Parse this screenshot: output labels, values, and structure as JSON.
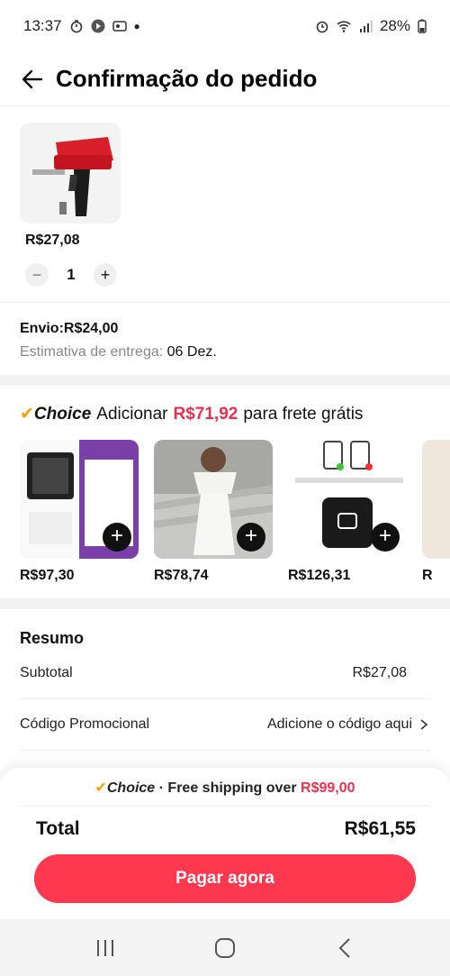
{
  "status": {
    "time": "13:37",
    "battery": "28%"
  },
  "header": {
    "title": "Confirmação do pedido"
  },
  "product": {
    "price": "R$27,08",
    "quantity": "1"
  },
  "shipping": {
    "label": "Envio:R$24,00",
    "estimate_label": "Estimativa de entrega:",
    "estimate_date": "06 Dez."
  },
  "choice": {
    "brand": "Choice",
    "add_text": "Adicionar",
    "amount": "R$71,92",
    "suffix": "para frete grátis",
    "items": [
      {
        "price": "R$97,30"
      },
      {
        "price": "R$78,74"
      },
      {
        "price": "R$126,31"
      },
      {
        "price": "R"
      }
    ]
  },
  "summary": {
    "title": "Resumo",
    "subtotal_label": "Subtotal",
    "subtotal_value": "R$27,08",
    "promo_label": "Código Promocional",
    "promo_value": "Adicione o código aqui"
  },
  "footer": {
    "banner_brand": "Choice",
    "banner_text": "· Free shipping over",
    "banner_amount": "R$99,00",
    "total_label": "Total",
    "total_value": "R$61,55",
    "pay_button": "Pagar agora"
  },
  "colors": {
    "accent": "#fd384f",
    "choice_check": "#f5a000",
    "price_red": "#e8304f"
  }
}
